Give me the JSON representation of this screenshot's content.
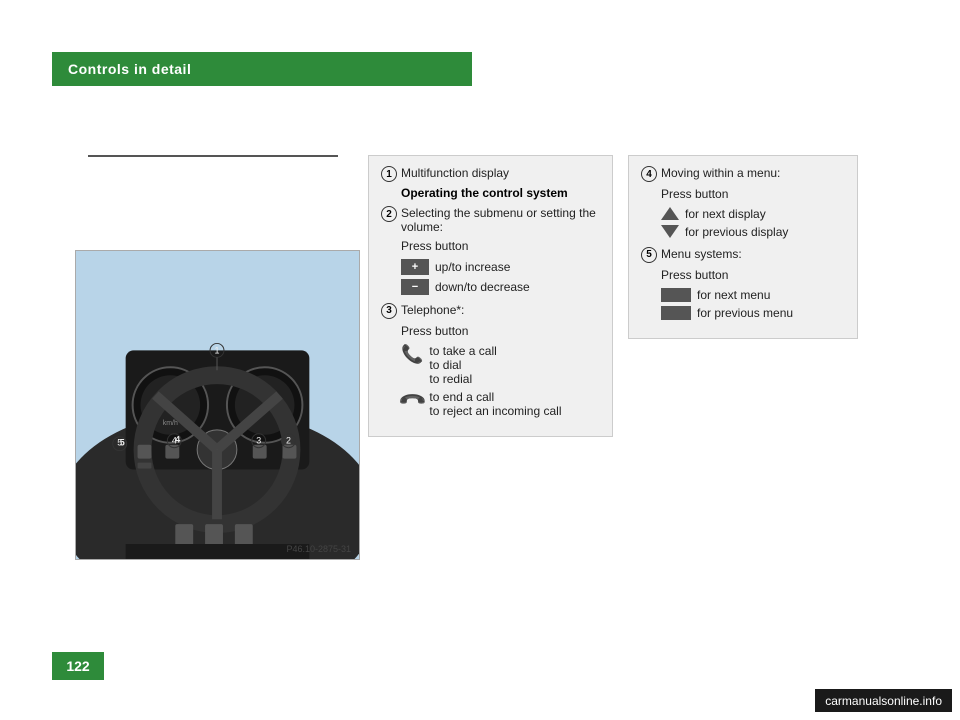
{
  "page": {
    "background": "#ffffff",
    "number": "122"
  },
  "header": {
    "title": "Controls in detail",
    "bg_color": "#2e8b3a"
  },
  "image_caption": "P46.10-2875-31",
  "left_box": {
    "item1_num": "1",
    "item1_label": "Multifunction display",
    "item1_bold": "Operating the control system",
    "item2_num": "2",
    "item2_label": "Selecting the submenu or setting the volume:",
    "item2_press": "Press button",
    "item2_btn1_label": "up/to increase",
    "item2_btn2_label": "down/to decrease",
    "item3_num": "3",
    "item3_label": "Telephone*:",
    "item3_press": "Press button",
    "item3_btn1_line1": "to take a call",
    "item3_btn1_line2": "to dial",
    "item3_btn1_line3": "to redial",
    "item3_btn2_line1": "to end a call",
    "item3_btn2_line2": "to reject an incoming call"
  },
  "right_box": {
    "item4_num": "4",
    "item4_label": "Moving within a menu:",
    "item4_press": "Press button",
    "item4_btn1_label": "for next display",
    "item4_btn2_label": "for previous display",
    "item5_num": "5",
    "item5_label": "Menu systems:",
    "item5_press": "Press button",
    "item5_btn1_label": "for next menu",
    "item5_btn2_label": "for previous menu"
  },
  "watermark": "carmanualsonline.info"
}
